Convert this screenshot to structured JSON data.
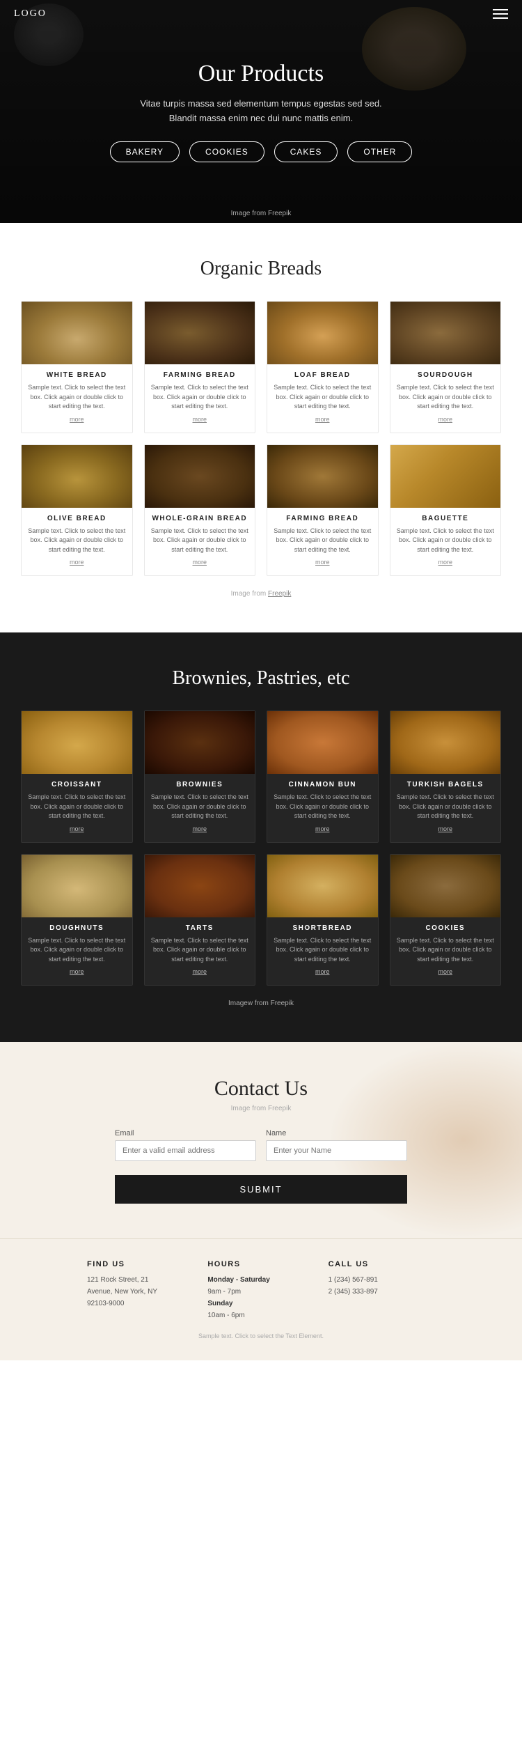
{
  "nav": {
    "logo": "logo",
    "menu_icon": "☰"
  },
  "hero": {
    "title": "Our Products",
    "subtitle": "Vitae turpis massa sed elementum tempus egestas sed sed. Blandit massa enim nec dui nunc mattis enim.",
    "buttons": [
      "BAKERY",
      "COOKIES",
      "CAKES",
      "OTHER"
    ],
    "image_credit": "Image from Freepik"
  },
  "organic_breads": {
    "section_title": "Organic Breads",
    "image_credit": "Image from",
    "image_credit_link": "Freepik",
    "products": [
      {
        "name": "WHITE BREAD",
        "desc": "Sample text. Click to select the text box. Click again or double click to start editing the text.",
        "more": "more",
        "img_class": "img-bread-white"
      },
      {
        "name": "FARMING BREAD",
        "desc": "Sample text. Click to select the text box. Click again or double click to start editing the text.",
        "more": "more",
        "img_class": "img-bread-farm"
      },
      {
        "name": "LOAF BREAD",
        "desc": "Sample text. Click to select the text box. Click again or double click to start editing the text.",
        "more": "more",
        "img_class": "img-bread-loaf"
      },
      {
        "name": "SOURDOUGH",
        "desc": "Sample text. Click to select the text box. Click again or double click to start editing the text.",
        "more": "more",
        "img_class": "img-bread-sour"
      },
      {
        "name": "OLIVE BREAD",
        "desc": "Sample text. Click to select the text box. Click again or double click to start editing the text.",
        "more": "more",
        "img_class": "img-bread-olive"
      },
      {
        "name": "WHOLE-GRAIN BREAD",
        "desc": "Sample text. Click to select the text box. Click again or double click to start editing the text.",
        "more": "more",
        "img_class": "img-bread-grain"
      },
      {
        "name": "FARMING BREAD",
        "desc": "Sample text. Click to select the text box. Click again or double click to start editing the text.",
        "more": "more",
        "img_class": "img-bread-farm2"
      },
      {
        "name": "BAGUETTE",
        "desc": "Sample text. Click to select the text box. Click again or double click to start editing the text.",
        "more": "more",
        "img_class": "img-bread-baguette"
      }
    ]
  },
  "brownies_section": {
    "section_title": "Brownies, Pastries, etc",
    "image_credit": "Imagew from Freepik",
    "products": [
      {
        "name": "CROISSANT",
        "desc": "Sample text. Click to select the text box. Click again or double click to start editing the text.",
        "more": "more",
        "img_class": "img-croissant"
      },
      {
        "name": "BROWNIES",
        "desc": "Sample text. Click to select the text box. Click again or double click to start editing the text.",
        "more": "more",
        "img_class": "img-brownies"
      },
      {
        "name": "CINNAMON BUN",
        "desc": "Sample text. Click to select the text box. Click again or double click to start editing the text.",
        "more": "more",
        "img_class": "img-cinnamon"
      },
      {
        "name": "TURKISH BAGELS",
        "desc": "Sample text. Click to select the text box. Click again or double click to start editing the text.",
        "more": "more",
        "img_class": "img-bagels"
      },
      {
        "name": "DOUGHNUTS",
        "desc": "Sample text. Click to select the text box. Click again or double click to start editing the text.",
        "more": "more",
        "img_class": "img-doughnuts"
      },
      {
        "name": "TARTS",
        "desc": "Sample text. Click to select the text box. Click again or double click to start editing the text.",
        "more": "more",
        "img_class": "img-tarts"
      },
      {
        "name": "SHORTBREAD",
        "desc": "Sample text. Click to select the text box. Click again or double click to start editing the text.",
        "more": "more",
        "img_class": "img-shortbread"
      },
      {
        "name": "COOKIES",
        "desc": "Sample text. Click to select the text box. Click again or double click to start editing the text.",
        "more": "more",
        "img_class": "img-cookies"
      }
    ]
  },
  "contact": {
    "title": "Contact Us",
    "image_credit": "Image from Freepik",
    "email_label": "Email",
    "email_placeholder": "Enter a valid email address",
    "name_label": "Name",
    "name_placeholder": "Enter your Name",
    "submit_label": "SUBMIT"
  },
  "footer": {
    "find_us_title": "FIND US",
    "find_us_address": "121 Rock Street, 21\nAvenue, New York, NY\n92103-9000",
    "hours_title": "HOURS",
    "hours_weekdays_label": "Monday - Saturday",
    "hours_weekdays": "9am - 7pm",
    "hours_sunday_label": "Sunday",
    "hours_sunday": "10am - 6pm",
    "call_us_title": "CALL US",
    "phone1": "1 (234) 567-891",
    "phone2": "2 (345) 333-897",
    "sample_text": "Sample text. Click to select the Text Element."
  }
}
